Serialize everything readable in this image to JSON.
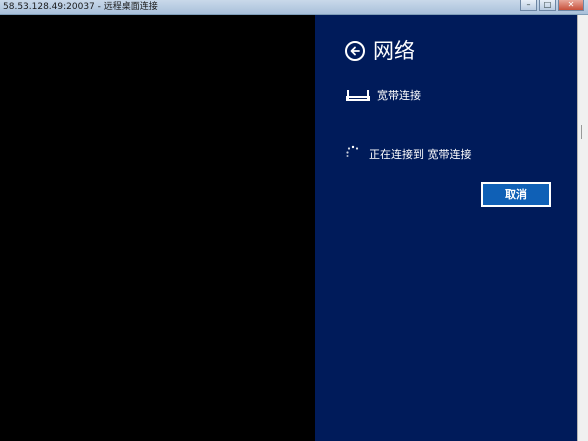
{
  "window": {
    "title": "58.53.128.49:20037 - 远程桌面连接",
    "minimize_icon": "minimize-icon",
    "maximize_icon": "maximize-icon",
    "close_icon": "close-icon"
  },
  "pane": {
    "back_icon": "back-arrow-icon",
    "title": "网络",
    "network": {
      "icon": "router-icon",
      "name": "宽带连接"
    },
    "status": {
      "icon": "spinner-icon",
      "text": "正在连接到 宽带连接"
    },
    "cancel_label": "取消"
  },
  "colors": {
    "pane_background": "#001b5a",
    "button_background": "#0f60b6",
    "text": "#ffffff",
    "remote_background": "#000000"
  }
}
